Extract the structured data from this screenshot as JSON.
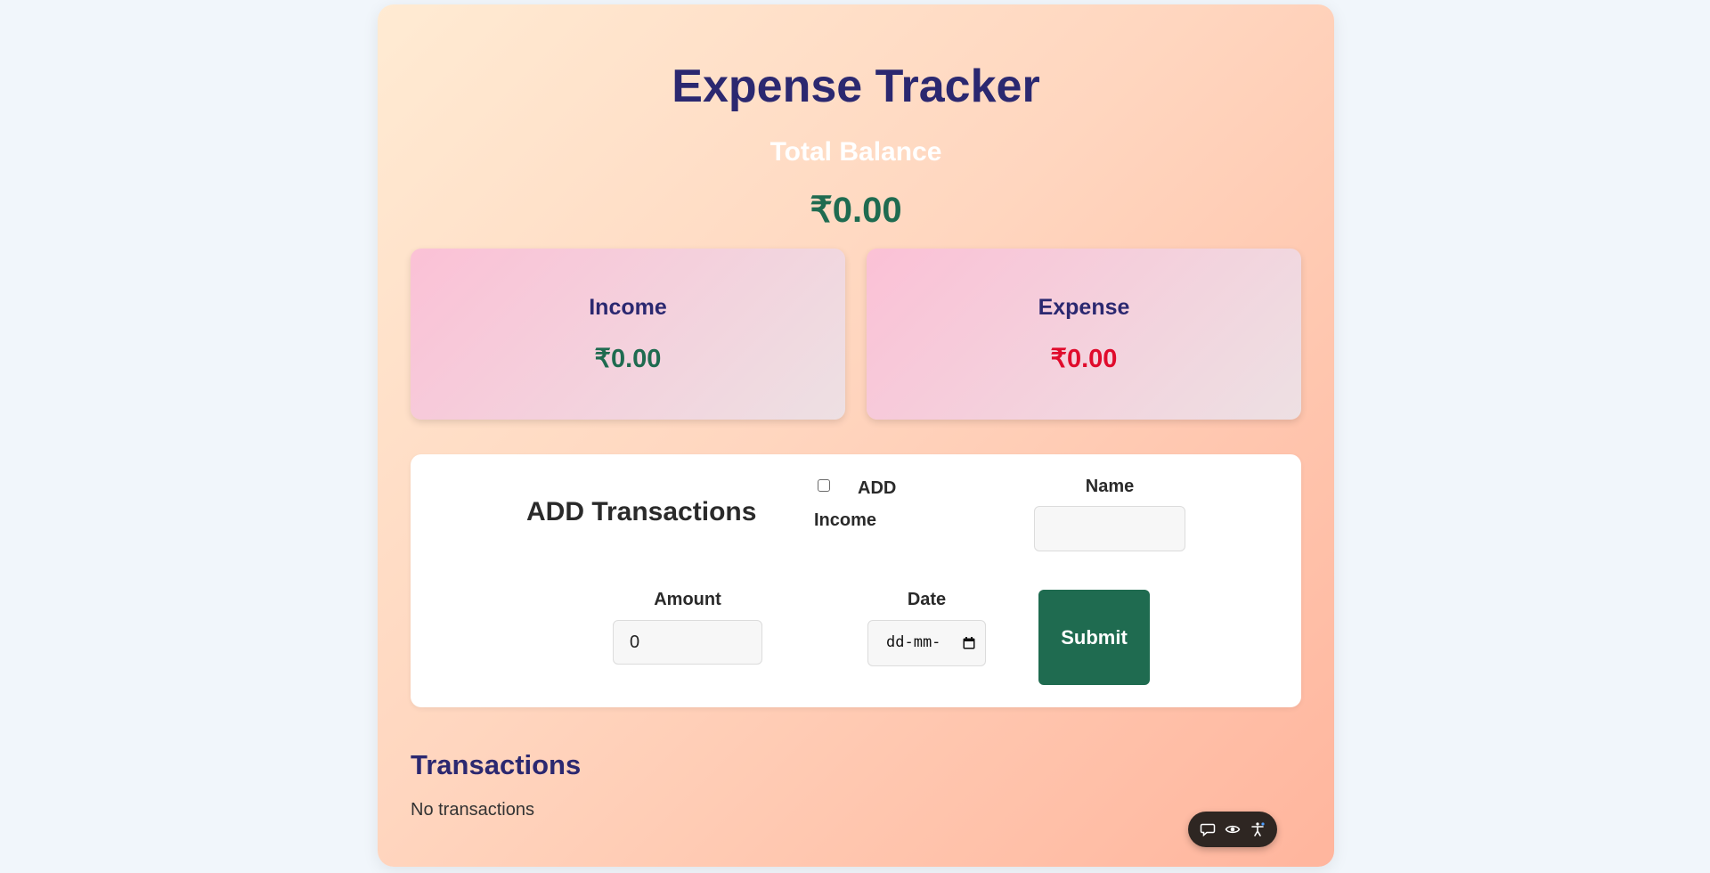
{
  "app": {
    "title": "Expense Tracker",
    "balance_label": "Total Balance",
    "balance_value": "₹0.00"
  },
  "summary": {
    "income": {
      "label": "Income",
      "value": "₹0.00",
      "color": "#1f6b50"
    },
    "expense": {
      "label": "Expense",
      "value": "₹0.00",
      "color": "#e00b2c"
    }
  },
  "form": {
    "heading": "ADD Transactions",
    "checkbox_label_line1": "ADD",
    "checkbox_label_line2": "Income",
    "checkbox_checked": false,
    "name_label": "Name",
    "name_value": "",
    "amount_label": "Amount",
    "amount_value": "0",
    "date_label": "Date",
    "date_placeholder": "dd-mm-",
    "submit_label": "Submit"
  },
  "transactions": {
    "heading": "Transactions",
    "empty_text": "No transactions",
    "items": []
  },
  "toolbar": {
    "icons": [
      "chat-icon",
      "eye-icon",
      "accessibility-icon"
    ]
  },
  "colors": {
    "accent_navy": "#2b2870",
    "accent_green": "#1f6b50",
    "expense_red": "#e00b2c"
  }
}
